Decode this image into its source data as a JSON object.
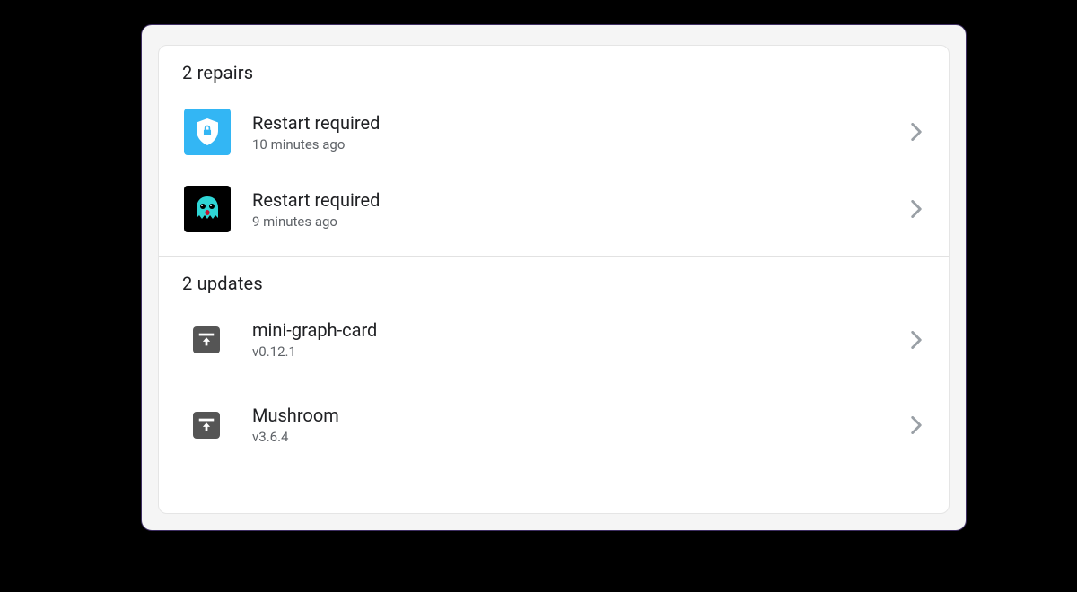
{
  "repairs": {
    "header": "2 repairs",
    "items": [
      {
        "title": "Restart required",
        "subtitle": "10 minutes ago"
      },
      {
        "title": "Restart required",
        "subtitle": "9 minutes ago"
      }
    ]
  },
  "updates": {
    "header": "2 updates",
    "items": [
      {
        "title": "mini-graph-card",
        "subtitle": "v0.12.1"
      },
      {
        "title": "Mushroom",
        "subtitle": "v3.6.4"
      }
    ]
  }
}
